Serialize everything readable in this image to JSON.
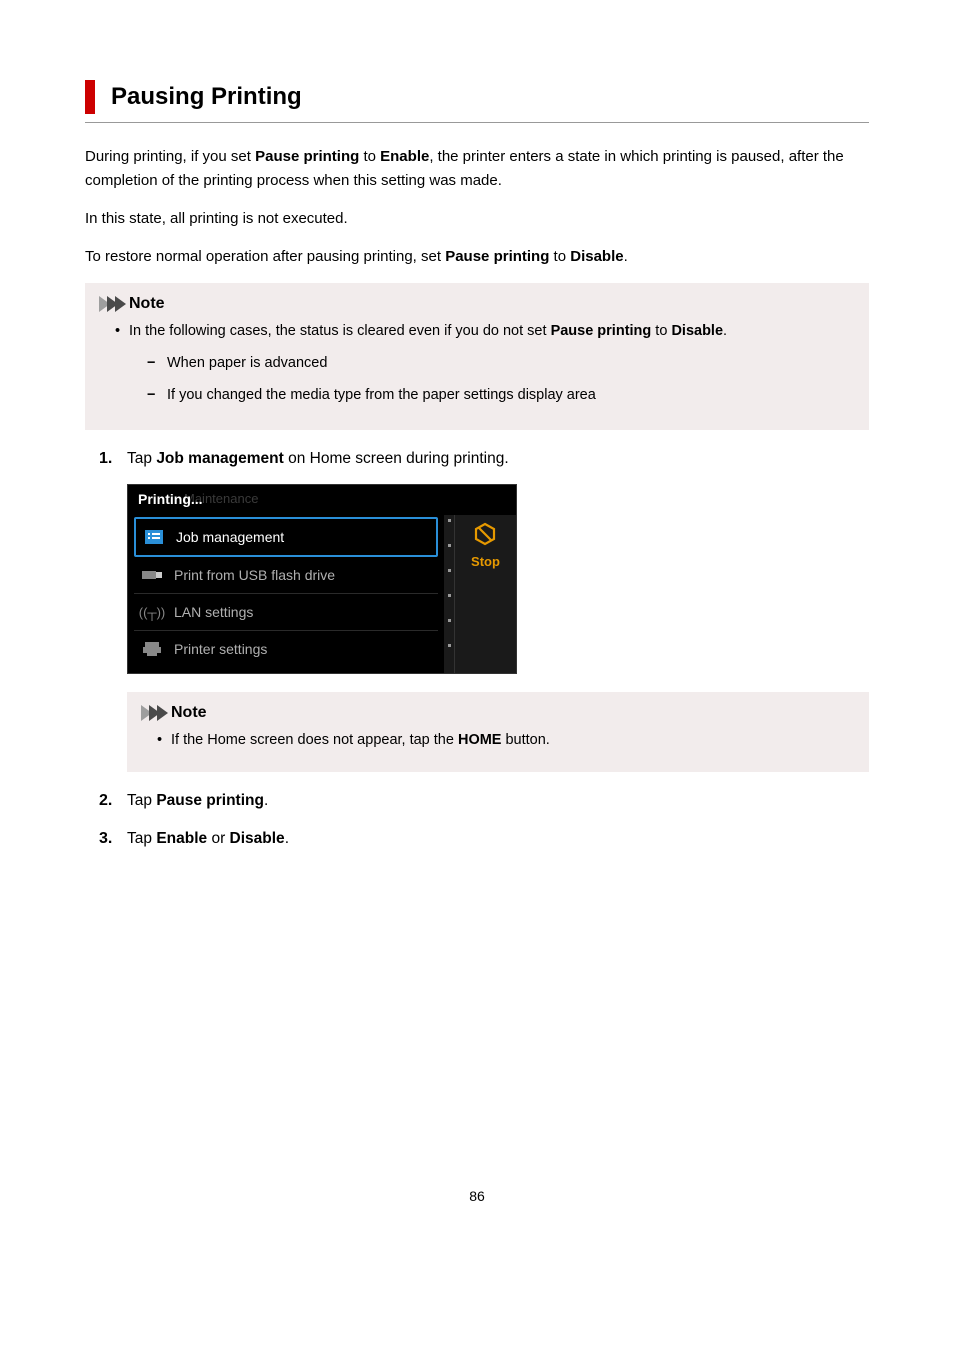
{
  "title": "Pausing Printing",
  "intro": {
    "p1_a": "During printing, if you set ",
    "p1_b": "Pause printing",
    "p1_c": " to ",
    "p1_d": "Enable",
    "p1_e": ", the printer enters a state in which printing is paused, after the completion of the printing process when this setting was made.",
    "p2": "In this state, all printing is not executed.",
    "p3_a": "To restore normal operation after pausing printing, set ",
    "p3_b": "Pause printing",
    "p3_c": " to ",
    "p3_d": "Disable",
    "p3_e": "."
  },
  "note1": {
    "title": "Note",
    "bullet_a": "In the following cases, the status is cleared even if you do not set ",
    "bullet_b": "Pause printing",
    "bullet_c": " to ",
    "bullet_d": "Disable",
    "bullet_e": ".",
    "sub1": "When paper is advanced",
    "sub2": "If you changed the media type from the paper settings display area"
  },
  "steps": {
    "s1_a": "Tap ",
    "s1_b": "Job management",
    "s1_c": " on Home screen during printing.",
    "s2_a": "Tap ",
    "s2_b": "Pause printing",
    "s2_c": ".",
    "s3_a": "Tap ",
    "s3_b": "Enable",
    "s3_c": " or ",
    "s3_d": "Disable",
    "s3_e": "."
  },
  "screen": {
    "ghost": "Maintenance",
    "printing": "Printing...",
    "menu1": "Job management",
    "menu2": "Print from USB flash drive",
    "menu3": "LAN settings",
    "menu4": "Printer settings",
    "stop": "Stop"
  },
  "note2": {
    "title": "Note",
    "bullet_a": "If the Home screen does not appear, tap the ",
    "bullet_b": "HOME",
    "bullet_c": " button."
  },
  "pagenum": "86"
}
